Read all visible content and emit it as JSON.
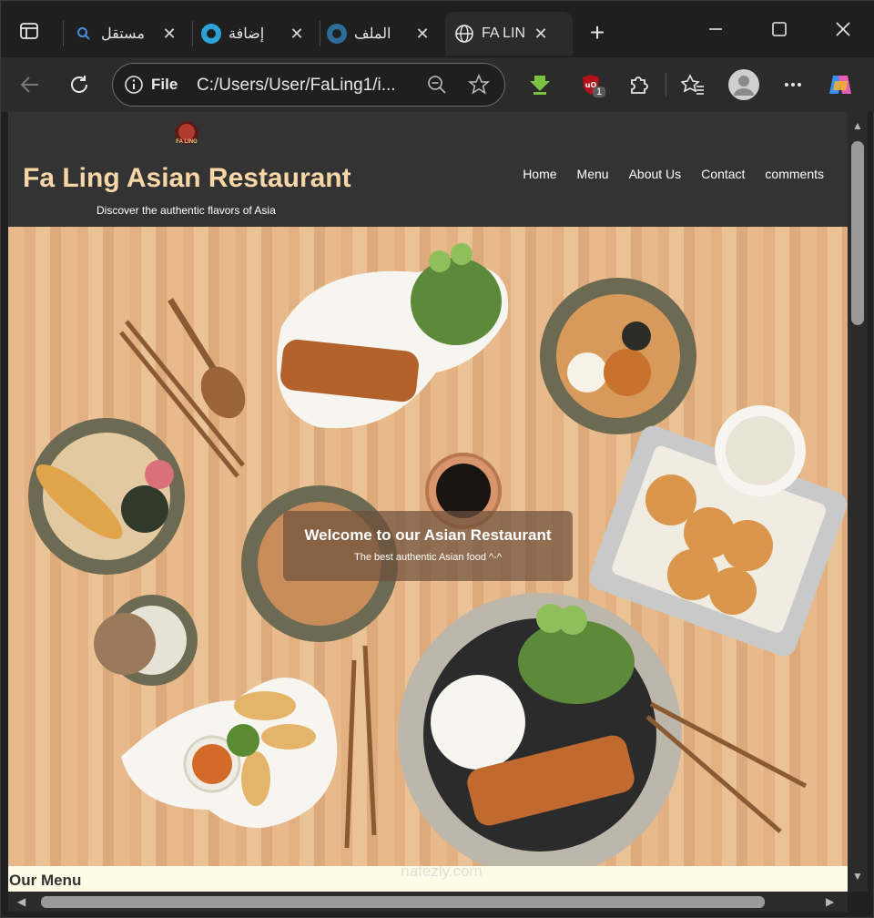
{
  "tabs": [
    {
      "title": "مستقل",
      "favicon": "search-icon",
      "active": false
    },
    {
      "title": "إضافة",
      "favicon": "circle-icon",
      "active": false
    },
    {
      "title": "الملف",
      "favicon": "circle-icon",
      "active": false
    },
    {
      "title": "FA LING",
      "favicon": "globe-icon",
      "active": true
    }
  ],
  "address_bar": {
    "scheme": "File",
    "url": "C:/Users/User/FaLing1/i..."
  },
  "extensions": {
    "ublock_badge": "1"
  },
  "site": {
    "logo_text": "FA LING",
    "title": "Fa Ling Asian Restaurant",
    "tagline": "Discover the authentic flavors of Asia",
    "nav": [
      "Home",
      "Menu",
      "About Us",
      "Contact",
      "comments"
    ]
  },
  "hero": {
    "heading": "Welcome to our Asian Restaurant",
    "subheading": "The best authentic Asian food ^-^"
  },
  "menu_section": {
    "heading": "Our Menu"
  },
  "watermark": "nafezly.com",
  "colors": {
    "header_bg": "#333333",
    "title_color": "#f7d6a8",
    "menu_strip_bg": "#fffbe6",
    "browser_chrome": "#2b2b2b"
  }
}
